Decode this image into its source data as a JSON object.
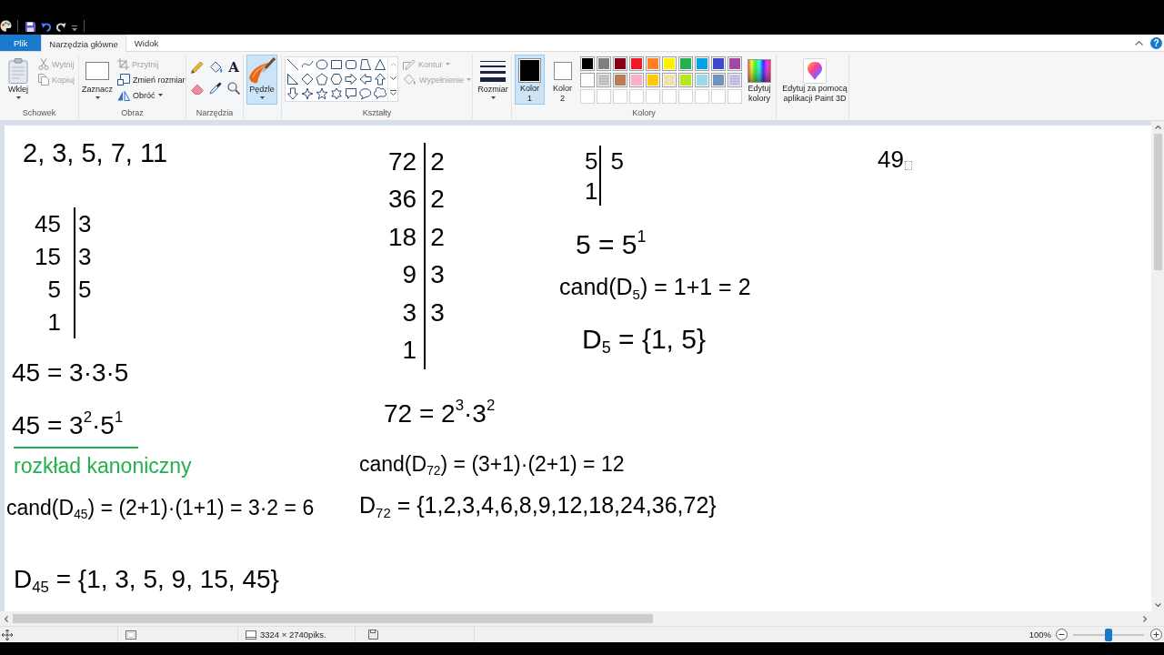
{
  "ribbon": {
    "tabs": [
      {
        "label": "Plik",
        "kind": "file",
        "selected": false
      },
      {
        "label": "Narzędzia główne",
        "kind": "tab",
        "selected": true
      },
      {
        "label": "Widok",
        "kind": "tab",
        "selected": false
      }
    ],
    "help": "?",
    "clipboard": {
      "label": "Schowek",
      "paste": "Wklej",
      "cut": {
        "label": "Wytnij",
        "disabled": true
      },
      "copy": {
        "label": "Kopiuj",
        "disabled": true
      }
    },
    "image": {
      "label": "Obraz",
      "select": "Zaznacz",
      "crop": {
        "label": "Przytnij",
        "disabled": true
      },
      "resize": {
        "label": "Zmień rozmiar",
        "disabled": false
      },
      "rotate": {
        "label": "Obróć",
        "disabled": false
      }
    },
    "tools": {
      "label": "Narzędzia",
      "text_tool": "A"
    },
    "brushes": {
      "label": "Pędzle",
      "selected": true
    },
    "shapes": {
      "label": "Kształty",
      "outline": {
        "label": "Kontur",
        "disabled": true
      },
      "fill": {
        "label": "Wypełnienie",
        "disabled": true
      }
    },
    "size": {
      "label": "Rozmiar"
    },
    "colors": {
      "label": "Kolory",
      "slots": [
        {
          "label": "Kolor 1",
          "color": "#000000",
          "selected": true
        },
        {
          "label": "Kolor 2",
          "color": "#ffffff",
          "selected": false
        }
      ],
      "palette": [
        {
          "kind": "color",
          "color": "#000000"
        },
        {
          "kind": "color",
          "color": "#7f7f7f"
        },
        {
          "kind": "color",
          "color": "#880015"
        },
        {
          "kind": "color",
          "color": "#ed1c24"
        },
        {
          "kind": "color",
          "color": "#ff7f27"
        },
        {
          "kind": "color",
          "color": "#fff200"
        },
        {
          "kind": "color",
          "color": "#22b14c"
        },
        {
          "kind": "color",
          "color": "#00a2e8"
        },
        {
          "kind": "color",
          "color": "#3f48cc"
        },
        {
          "kind": "color",
          "color": "#a349a4"
        },
        {
          "kind": "color",
          "color": "#ffffff"
        },
        {
          "kind": "color",
          "color": "#c3c3c3"
        },
        {
          "kind": "color",
          "color": "#b97a57"
        },
        {
          "kind": "color",
          "color": "#ffaec9"
        },
        {
          "kind": "color",
          "color": "#ffc90e"
        },
        {
          "kind": "color",
          "color": "#efe4b0"
        },
        {
          "kind": "color",
          "color": "#b5e61d"
        },
        {
          "kind": "color",
          "color": "#99d9ea"
        },
        {
          "kind": "color",
          "color": "#7092be"
        },
        {
          "kind": "color",
          "color": "#c8bfe7"
        },
        {
          "kind": "empty"
        },
        {
          "kind": "empty"
        },
        {
          "kind": "empty"
        },
        {
          "kind": "empty"
        },
        {
          "kind": "empty"
        },
        {
          "kind": "empty"
        },
        {
          "kind": "empty"
        },
        {
          "kind": "empty"
        },
        {
          "kind": "empty"
        },
        {
          "kind": "empty"
        }
      ],
      "edit": "Edytuj kolory"
    },
    "paint3d": {
      "label": "Edytuj za pomocą aplikacji Paint 3D"
    }
  },
  "canvas": {
    "notes": [
      {
        "kind": "formula",
        "text": "2, 3, 5, 7, 11",
        "color": "#000000"
      },
      {
        "kind": "ladder",
        "color": "#000000",
        "rows": [
          {
            "number": "45",
            "factor": "3"
          },
          {
            "number": "15",
            "factor": "3"
          },
          {
            "number": "5",
            "factor": "5"
          },
          {
            "number": "1"
          }
        ]
      },
      {
        "kind": "formula",
        "text": "45 = 3·3·5",
        "color": "#000000"
      },
      {
        "kind": "formula",
        "text": "45 = 3$^{2}$·5$^{1}$",
        "color": "#000000"
      },
      {
        "kind": "label",
        "text": "rozkład kanoniczny",
        "color": "#22b14c"
      },
      {
        "kind": "formula",
        "text": "cand(D$_{45}$) = (2+1)·(1+1) = 3·2 = 6",
        "color": "#000000"
      },
      {
        "kind": "formula",
        "text": "D$_{45}$ = {1, 3, 5, 9, 15, 45}",
        "color": "#000000"
      },
      {
        "kind": "ladder",
        "color": "#000000",
        "rows": [
          {
            "number": "72",
            "factor": "2"
          },
          {
            "number": "36",
            "factor": "2"
          },
          {
            "number": "18",
            "factor": "2"
          },
          {
            "number": "9",
            "factor": "3"
          },
          {
            "number": "3",
            "factor": "3"
          },
          {
            "number": "1"
          }
        ]
      },
      {
        "kind": "formula",
        "text": "72 = 2$^{3}$·3$^{2}$",
        "color": "#000000"
      },
      {
        "kind": "formula",
        "text": "cand(D$_{72}$) = (3+1)·(2+1) = 12",
        "color": "#000000"
      },
      {
        "kind": "formula",
        "text": "D$_{72}$ = {1,2,3,4,6,8,9,12,18,24,36,72}",
        "color": "#000000"
      },
      {
        "kind": "ladder",
        "color": "#000000",
        "rows": [
          {
            "number": "5",
            "factor": "5"
          },
          {
            "number": "1"
          }
        ]
      },
      {
        "kind": "formula",
        "text": "5 = 5$^{1}$",
        "color": "#000000"
      },
      {
        "kind": "formula",
        "text": "cand(D$_{5}$) = 1+1 = 2",
        "color": "#000000"
      },
      {
        "kind": "formula",
        "text": "D$_{5}$ = {1, 5}",
        "color": "#000000"
      },
      {
        "kind": "typed",
        "text": "49",
        "color": "#000000"
      }
    ]
  },
  "status_bar": {
    "dimensions": "3324 × 2740piks.",
    "zoom": "100%",
    "zoom_slider": {
      "level": 0.5
    }
  }
}
